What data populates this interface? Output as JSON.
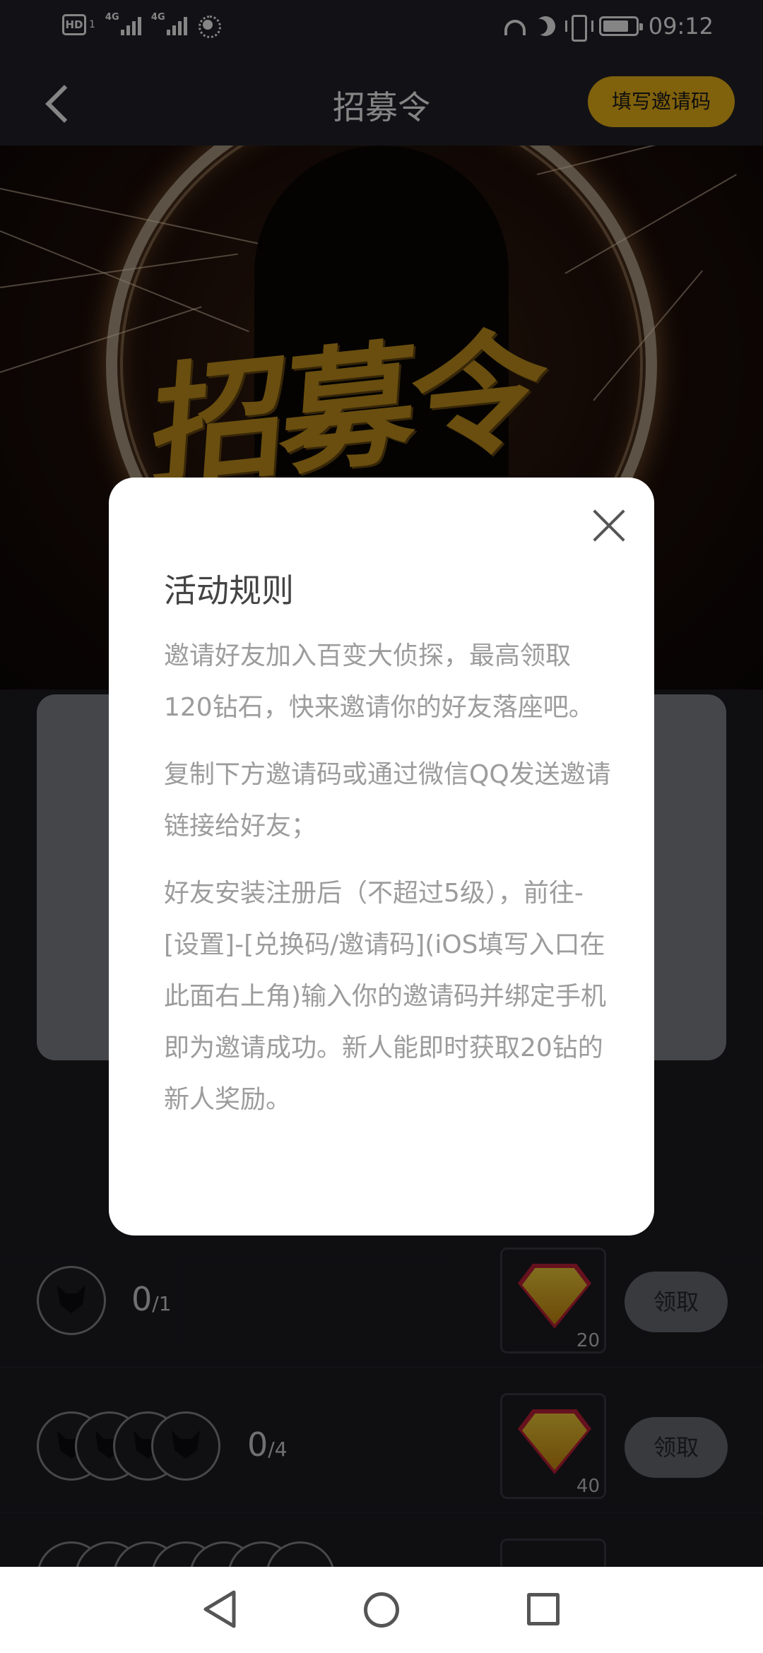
{
  "status_bar": {
    "hd": "HD",
    "hd_sub": "1",
    "signal_1_label": "4G",
    "signal_2_label": "4G",
    "battery_level": 0.8,
    "time": "09:12"
  },
  "header": {
    "title": "招募令",
    "invite_code_button": "填写邀请码"
  },
  "banner": {
    "title": "招募令"
  },
  "dialog": {
    "title": "活动规则",
    "rules": [
      "邀请好友加入百变大侦探，最高领取120钻石，快来邀请你的好友落座吧。",
      "复制下方邀请码或通过微信QQ发送邀请链接给好友；",
      "好友安装注册后（不超过5级），前往-[设置]-[兑换码/邀请码](iOS填写入口在此面右上角)输入你的邀请码并绑定手机即为邀请成功。新人能即时获取20钻的新人奖励。"
    ]
  },
  "rewards": [
    {
      "progress": "0",
      "target": "/1",
      "gems": "20",
      "claim_label": "领取"
    },
    {
      "progress": "0",
      "target": "/4",
      "gems": "40",
      "claim_label": "领取"
    }
  ],
  "colors": {
    "accent": "#f6bb17",
    "header_bg": "#24232b",
    "page_bg": "#1d1c22"
  }
}
